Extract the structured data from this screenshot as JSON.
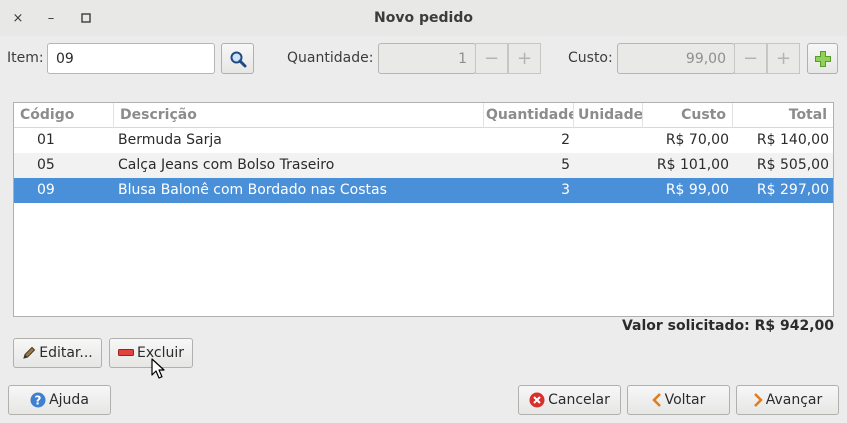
{
  "window": {
    "title": "Novo pedido",
    "close_glyph": "×",
    "min_glyph": "–",
    "max_glyph": "□"
  },
  "form": {
    "item_label": "Item:",
    "item_value": "09",
    "qty_label": "Quantidade:",
    "qty_value": "1",
    "cost_label": "Custo:",
    "cost_value": "99,00",
    "minus": "−",
    "plus": "+"
  },
  "table": {
    "columns": [
      "Código",
      "Descrição",
      "Quantidade",
      "Unidade",
      "Custo",
      "Total"
    ],
    "rows": [
      {
        "codigo": "01",
        "descricao": "Bermuda Sarja",
        "quantidade": "2",
        "unidade": "",
        "custo": "R$ 70,00",
        "total": "R$ 140,00"
      },
      {
        "codigo": "05",
        "descricao": "Calça Jeans com Bolso Traseiro",
        "quantidade": "5",
        "unidade": "",
        "custo": "R$ 101,00",
        "total": "R$ 505,00"
      },
      {
        "codigo": "09",
        "descricao": "Blusa Balonê com Bordado nas Costas",
        "quantidade": "3",
        "unidade": "",
        "custo": "R$ 99,00",
        "total": "R$ 297,00"
      }
    ],
    "selected_row": 2
  },
  "summary": {
    "label": "Valor solicitado:",
    "value": "R$ 942,00"
  },
  "actions": {
    "edit": "Editar...",
    "delete": "Excluir",
    "help": "Ajuda",
    "cancel": "Cancelar",
    "back": "Voltar",
    "next": "Avançar"
  },
  "colors": {
    "selection": "#4a90d9",
    "add_icon": "#7cc04a",
    "delete_icon": "#d9302c",
    "cancel_icon": "#d9302c",
    "nav_arrow": "#e07b1f",
    "help_icon": "#3f7fd0"
  }
}
